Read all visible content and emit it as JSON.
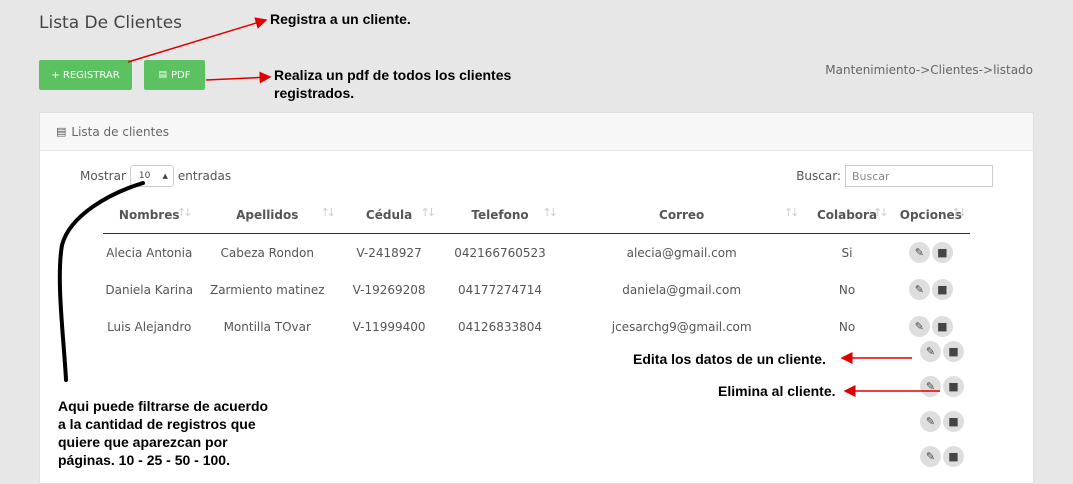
{
  "page": {
    "title": "Lista De Clientes",
    "breadcrumb": "Mantenimiento->Clientes->listado"
  },
  "toolbar": {
    "register_label": "+ REGISTRAR",
    "pdf_label": "PDF"
  },
  "card": {
    "header_title": "Lista de clientes",
    "length": {
      "prefix": "Mostrar",
      "value": "10",
      "suffix": "entradas",
      "options": [
        "10",
        "25",
        "50",
        "100"
      ]
    },
    "search": {
      "label": "Buscar:",
      "placeholder": "Buscar"
    }
  },
  "table": {
    "columns": [
      "Nombres",
      "Apellidos",
      "Cédula",
      "Telefono",
      "Correo",
      "Colabora",
      "Opciones"
    ],
    "rows": [
      {
        "nombres": "Alecia Antonia",
        "apellidos": "Cabeza Rondon",
        "cedula": "V-2418927",
        "telefono": "042166760523",
        "correo": "alecia@gmail.com",
        "colabora": "Si"
      },
      {
        "nombres": "Daniela Karina",
        "apellidos": "Zarmiento matinez",
        "cedula": "V-19269208",
        "telefono": "04177274714",
        "correo": "daniela@gmail.com",
        "colabora": "No"
      },
      {
        "nombres": "Luis Alejandro",
        "apellidos": "Montilla TOvar",
        "cedula": "V-11999400",
        "telefono": "04126833804",
        "correo": "jcesarchg9@gmail.com",
        "colabora": "No"
      }
    ]
  },
  "annotations": {
    "register": "Registra a un cliente.",
    "pdf_line1": "Realiza un pdf de todos los clientes",
    "pdf_line2": "registrados.",
    "edit": "Edita los datos de un cliente.",
    "delete": "Elimina al cliente.",
    "filter_line1": "Aqui puede filtrarse de acuerdo",
    "filter_line2": "a la cantidad de registros que",
    "filter_line3": "quiere que aparezcan por",
    "filter_line4": "páginas. 10 - 25 - 50 - 100."
  },
  "icons": {
    "edit": "pencil-icon",
    "delete": "trash-icon",
    "list": "list-icon",
    "pdf": "document-icon"
  },
  "colors": {
    "button_green": "#5cc261",
    "annotation_arrow": "#e00000",
    "background": "#e7e7e7"
  }
}
